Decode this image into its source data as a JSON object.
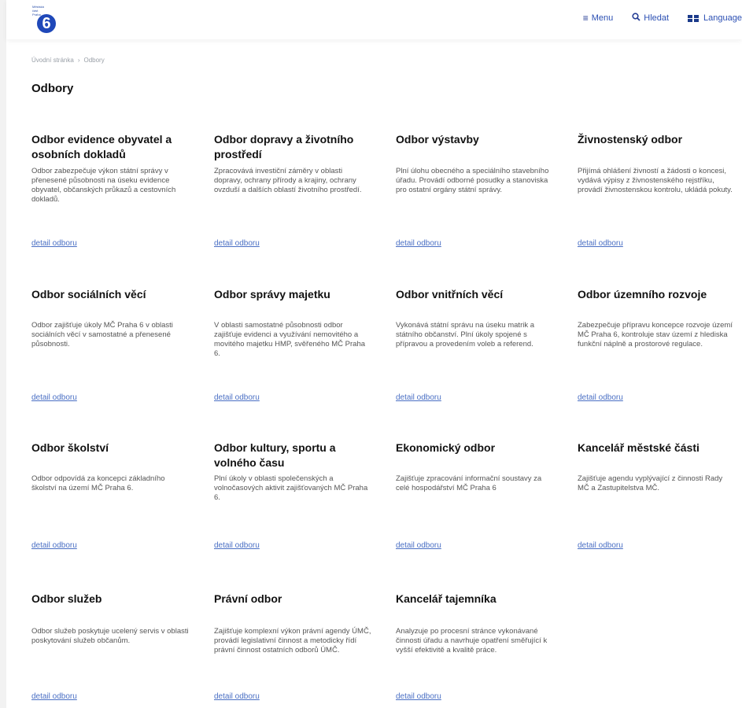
{
  "header": {
    "logo_text": [
      "Městská",
      "část",
      "Praha"
    ],
    "logo_number": "6",
    "menu_label": "Menu",
    "search_label": "Hledat",
    "language_label": "Language"
  },
  "breadcrumb": {
    "home": "Úvodní stránka",
    "current": "Odbory"
  },
  "page_title": "Odbory",
  "link_label": "detail odboru",
  "departments": [
    {
      "title": "Odbor evidence obyvatel a osobních dokladů",
      "description": "Odbor zabezpečuje výkon státní správy v přenesené působnosti na úseku evidence obyvatel, občanských průkazů a cestovních dokladů."
    },
    {
      "title": "Odbor dopravy a životního prostředí",
      "description": "Zpracovává investiční záměry v oblasti dopravy, ochrany přírody a krajiny, ochrany ovzduší a dalších oblastí životního prostředí."
    },
    {
      "title": "Odbor výstavby",
      "description": "Plní úlohu obecného a speciálního stavebního úřadu. Provádí odborné posudky a stanoviska pro ostatní orgány státní správy."
    },
    {
      "title": "Živnostenský odbor",
      "description": "Přijímá ohlášení živností a žádosti o koncesi, vydává výpisy z živnostenského rejstříku, provádí živnostenskou kontrolu, ukládá pokuty."
    },
    {
      "title": "Odbor sociálních věcí",
      "description": "Odbor zajišťuje úkoly MČ Praha 6 v oblasti sociálních věcí v samostatné a přenesené působnosti."
    },
    {
      "title": "Odbor správy majetku",
      "description": "V oblasti samostatné působnosti odbor zajišťuje evidenci a využívání nemovitého a movitého majetku HMP, svěřeného MČ Praha 6."
    },
    {
      "title": "Odbor vnitřních věcí",
      "description": "Vykonává státní správu na úseku matrik a státního občanství. Plní úkoly spojené s přípravou a provedením voleb a referend."
    },
    {
      "title": "Odbor územního rozvoje",
      "description": "Zabezpečuje přípravu koncepce rozvoje území MČ Praha 6, kontroluje stav území z hlediska funkční náplně a prostorové regulace."
    },
    {
      "title": "Odbor školství",
      "description": "Odbor odpovídá za koncepci základního školství na území MČ Praha 6."
    },
    {
      "title": "Odbor kultury, sportu a volného času",
      "description": "Plní úkoly v oblasti společenských a volnočasových aktivit zajišťovaných MČ Praha 6."
    },
    {
      "title": "Ekonomický odbor",
      "description": "Zajišťuje zpracování informační soustavy za celé hospodářství MČ Praha 6"
    },
    {
      "title": "Kancelář městské části",
      "description": "Zajišťuje agendu vyplývající z činnosti Rady MČ a Zastupitelstva MČ."
    },
    {
      "title": "Odbor služeb",
      "description": "Odbor služeb poskytuje ucelený servis v oblasti poskytování služeb občanům."
    },
    {
      "title": "Právní odbor",
      "description": "Zajišťuje komplexní výkon právní agendy ÚMČ, provádí legislativní činnost a metodicky řídí právní činnost ostatních odborů ÚMČ."
    },
    {
      "title": "Kancelář tajemníka",
      "description": "Analyzuje po procesní stránce vykonávané činnosti úřadu a navrhuje opatření směřující k vyšší efektivitě a kvalitě práce."
    }
  ]
}
